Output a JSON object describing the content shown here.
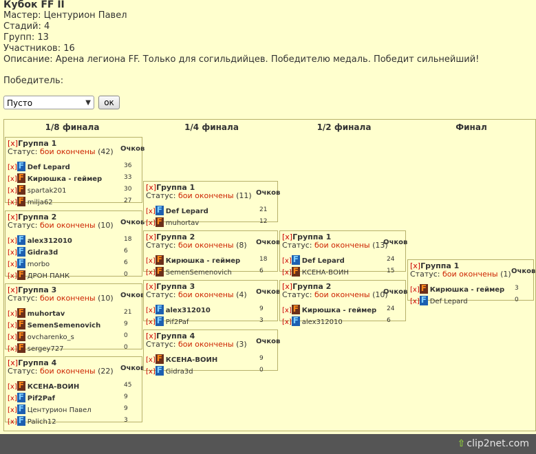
{
  "header": {
    "title": "Кубок FF II",
    "lines": [
      "Мастер: Центурион Павел",
      "Стадий: 4",
      "Групп: 13",
      "Участников: 16",
      "Описание: Арена легиона FF. Только для согильдийцев. Победителю медаль. Победит сильнейший!"
    ]
  },
  "winner_label": "Победитель:",
  "winner_select": {
    "value": "Пусто"
  },
  "ok_button": "ок",
  "stages": [
    "1/8 финала",
    "1/4 финала",
    "1/2 финала",
    "Финал"
  ],
  "labels": {
    "x": "[x]",
    "status": "Статус:",
    "status_value": "бои окончены",
    "points": "Очков"
  },
  "groups": [
    {
      "title": "Группа 1",
      "count": "(42)",
      "players": [
        {
          "name": "Def Lepard",
          "pts": "36",
          "bold": true,
          "av": "F"
        },
        {
          "name": "Кирюшка - геймер",
          "pts": "33",
          "bold": true,
          "av": "Fa"
        },
        {
          "name": "spartak201",
          "pts": "30",
          "bold": false,
          "av": "Fa"
        },
        {
          "name": "milja62",
          "pts": "27",
          "bold": false,
          "av": "Fa"
        }
      ]
    },
    {
      "title": "Группа 2",
      "count": "(10)",
      "players": [
        {
          "name": "alex312010",
          "pts": "18",
          "bold": true,
          "av": "F"
        },
        {
          "name": "Gidra3d",
          "pts": "6",
          "bold": true,
          "av": "F"
        },
        {
          "name": "morbo",
          "pts": "6",
          "bold": false,
          "av": "F"
        },
        {
          "name": "ДРОН ПАНК",
          "pts": "0",
          "bold": false,
          "av": "Fa"
        }
      ]
    },
    {
      "title": "Группа 3",
      "count": "(10)",
      "players": [
        {
          "name": "muhortav",
          "pts": "21",
          "bold": true,
          "av": "Fa"
        },
        {
          "name": "SemenSemenovich",
          "pts": "9",
          "bold": true,
          "av": "Fa"
        },
        {
          "name": "ovcharenko_s",
          "pts": "0",
          "bold": false,
          "av": "Fa"
        },
        {
          "name": "sergey727",
          "pts": "0",
          "bold": false,
          "av": "Fa"
        }
      ]
    },
    {
      "title": "Группа 4",
      "count": "(22)",
      "players": [
        {
          "name": "КСЕНА-ВОИН",
          "pts": "45",
          "bold": true,
          "av": "Fa"
        },
        {
          "name": "Pif2Paf",
          "pts": "9",
          "bold": true,
          "av": "F"
        },
        {
          "name": "Центурион Павел",
          "pts": "9",
          "bold": false,
          "av": "F"
        },
        {
          "name": "Palich12",
          "pts": "3",
          "bold": false,
          "av": "F"
        }
      ]
    },
    {
      "title": "Группа 1",
      "count": "(11)",
      "players": [
        {
          "name": "Def Lepard",
          "pts": "21",
          "bold": true,
          "av": "F"
        },
        {
          "name": "muhortav",
          "pts": "12",
          "bold": false,
          "av": "Fa"
        }
      ]
    },
    {
      "title": "Группа 2",
      "count": "(8)",
      "players": [
        {
          "name": "Кирюшка - геймер",
          "pts": "18",
          "bold": true,
          "av": "Fa"
        },
        {
          "name": "SemenSemenovich",
          "pts": "6",
          "bold": false,
          "av": "Fa"
        }
      ]
    },
    {
      "title": "Группа 3",
      "count": "(4)",
      "players": [
        {
          "name": "alex312010",
          "pts": "9",
          "bold": true,
          "av": "F"
        },
        {
          "name": "Pif2Paf",
          "pts": "3",
          "bold": false,
          "av": "F"
        }
      ]
    },
    {
      "title": "Группа 4",
      "count": "(3)",
      "players": [
        {
          "name": "КСЕНА-ВОИН",
          "pts": "9",
          "bold": true,
          "av": "Fa"
        },
        {
          "name": "Gidra3d",
          "pts": "0",
          "bold": false,
          "av": "F"
        }
      ]
    },
    {
      "title": "Группа 1",
      "count": "(13)",
      "players": [
        {
          "name": "Def Lepard",
          "pts": "24",
          "bold": true,
          "av": "F"
        },
        {
          "name": "КСЕНА-ВОИН",
          "pts": "15",
          "bold": false,
          "av": "Fa"
        }
      ]
    },
    {
      "title": "Группа 2",
      "count": "(10)",
      "players": [
        {
          "name": "Кирюшка - геймер",
          "pts": "24",
          "bold": true,
          "av": "Fa"
        },
        {
          "name": "alex312010",
          "pts": "6",
          "bold": false,
          "av": "F"
        }
      ]
    },
    {
      "title": "Группа 1",
      "count": "(1)",
      "players": [
        {
          "name": "Кирюшка - геймер",
          "pts": "3",
          "bold": true,
          "av": "Fa"
        },
        {
          "name": "Def Lepard",
          "pts": "0",
          "bold": false,
          "av": "F"
        }
      ]
    }
  ],
  "footer_logo": "clip2net.com"
}
